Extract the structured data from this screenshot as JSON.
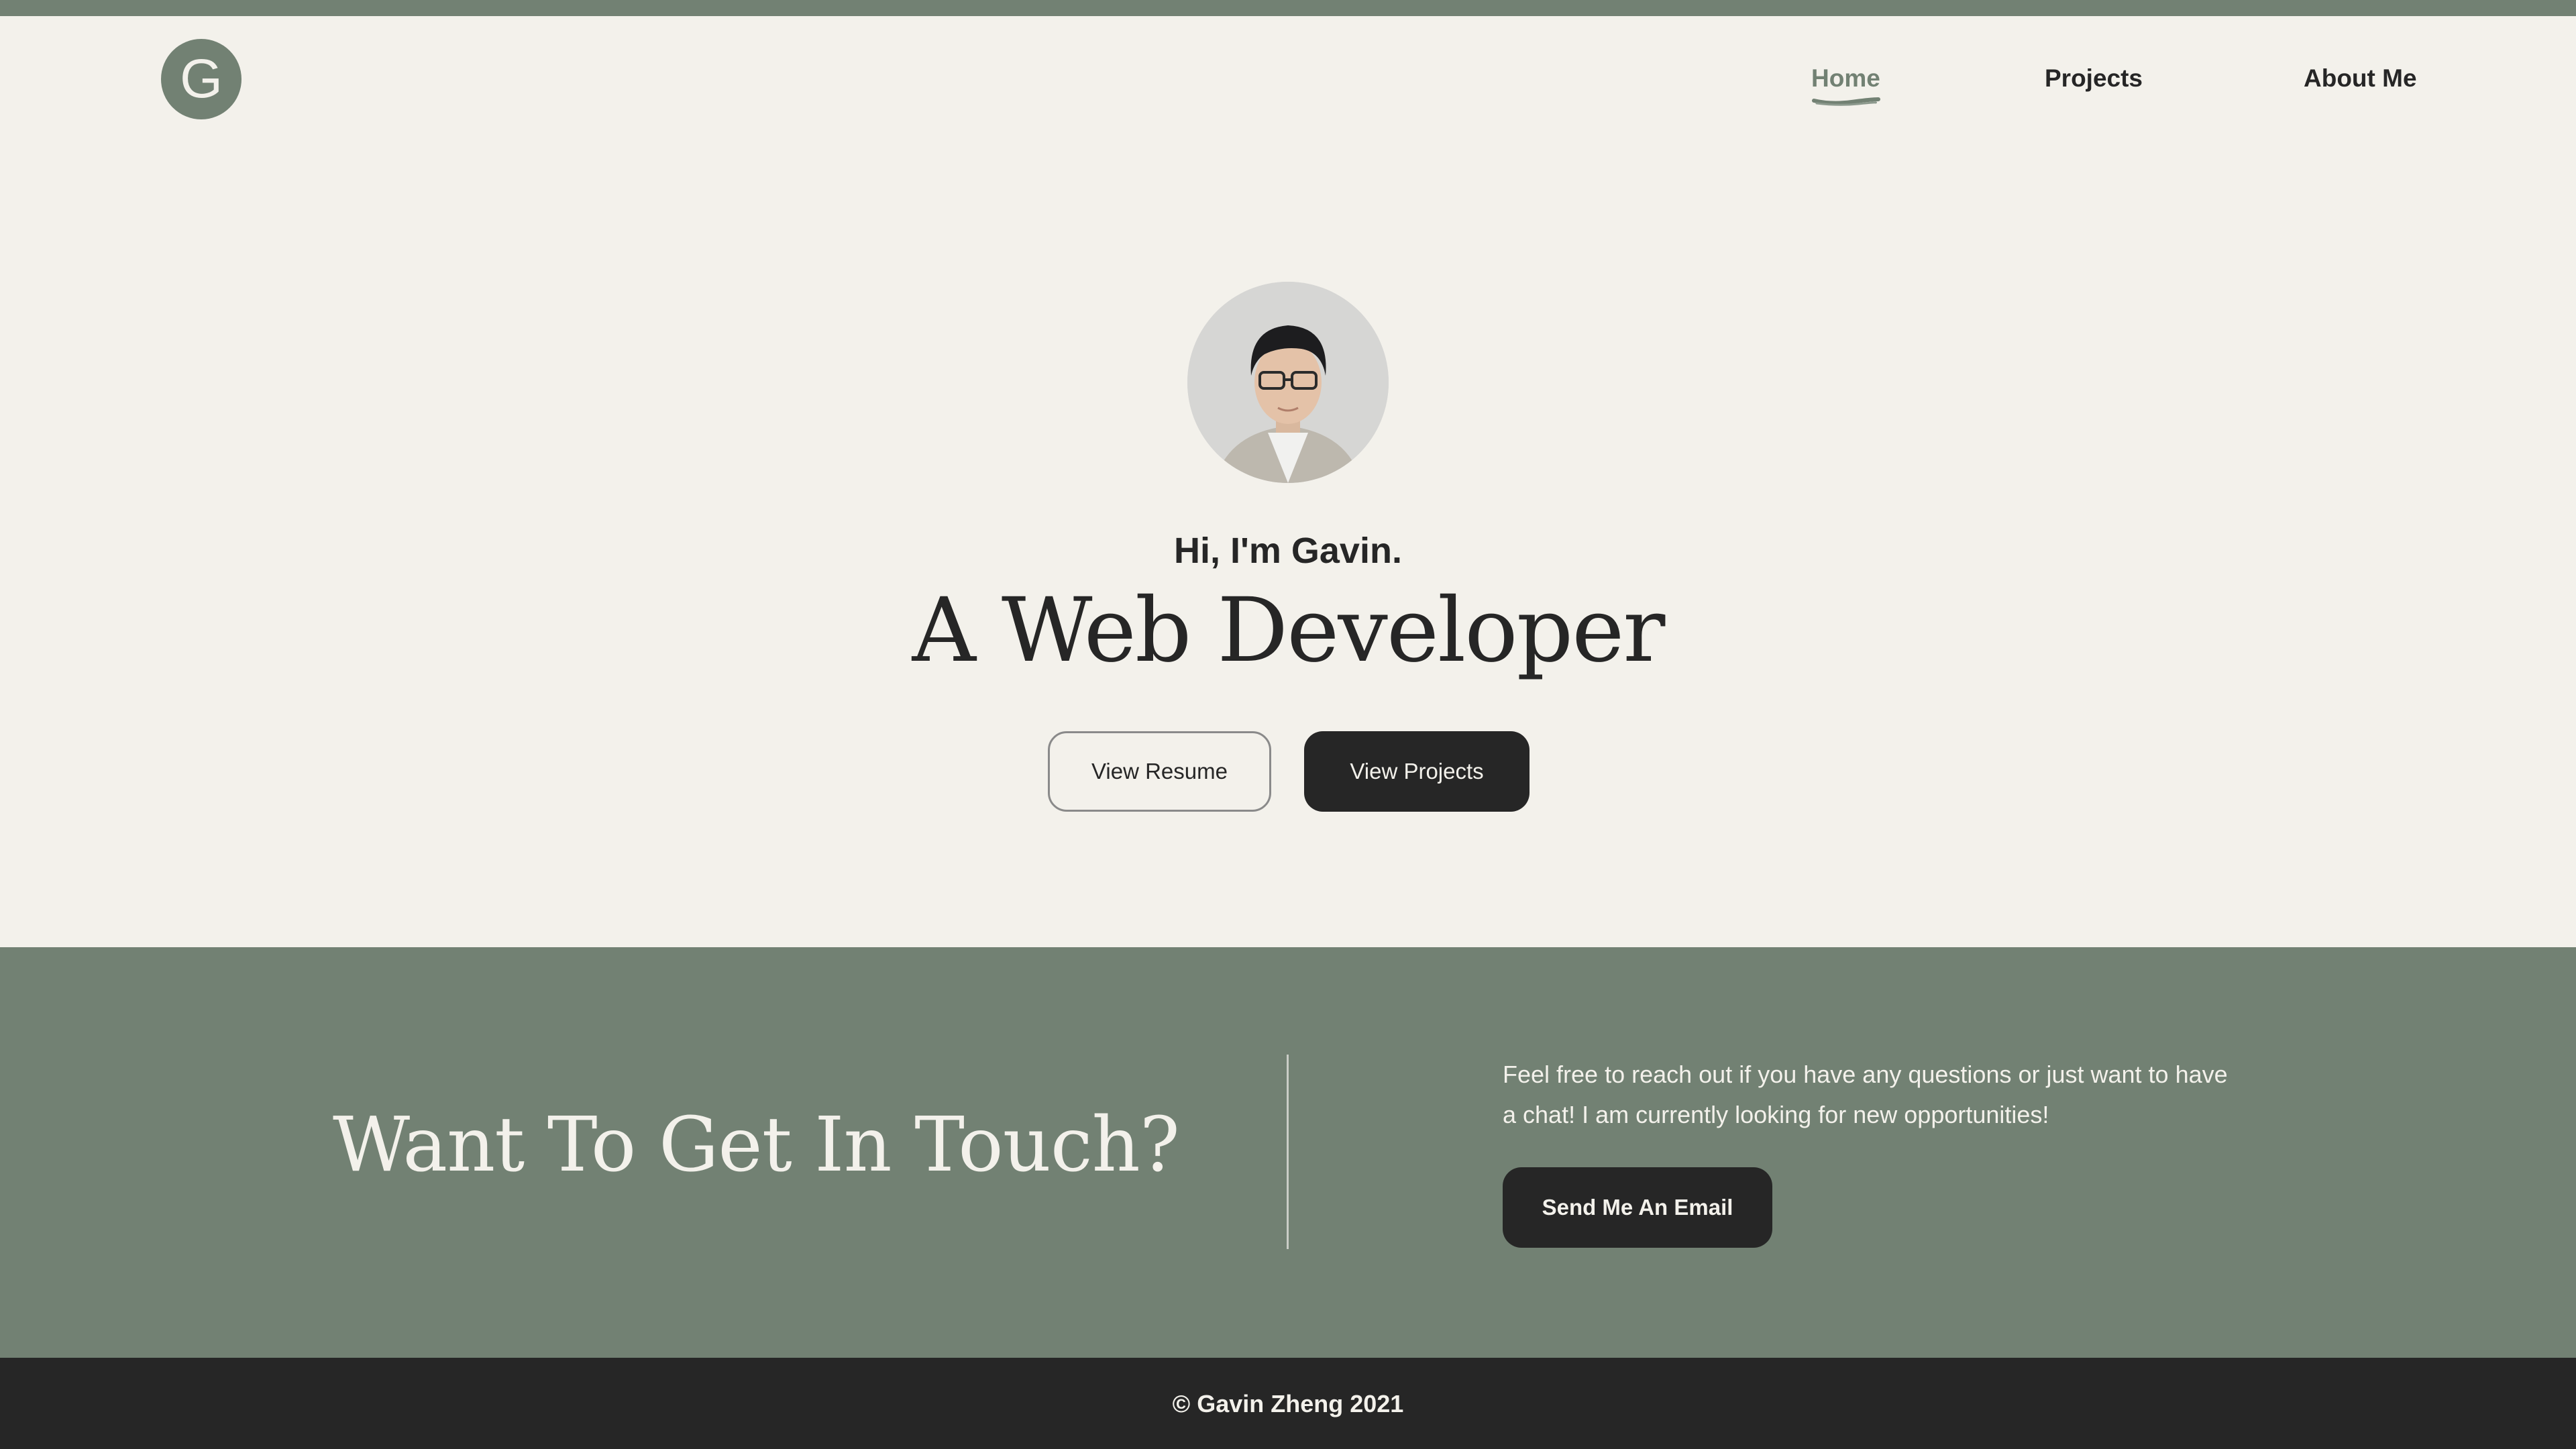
{
  "header": {
    "logo_letter": "G",
    "nav": [
      {
        "label": "Home",
        "active": true
      },
      {
        "label": "Projects",
        "active": false
      },
      {
        "label": "About Me",
        "active": false
      }
    ]
  },
  "hero": {
    "greeting": "Hi, I'm Gavin.",
    "headline": "A Web Developer",
    "resume_button": "View Resume",
    "projects_button": "View Projects"
  },
  "contact": {
    "title": "Want To Get In Touch?",
    "text": "Feel free to reach out if you have any questions or just want to have a chat! I am currently looking for new opportunities!",
    "email_button": "Send Me An Email"
  },
  "footer": {
    "copyright": "© Gavin Zheng 2021"
  },
  "colors": {
    "accent": "#728173",
    "dark": "#262626",
    "background": "#f3f1eb"
  }
}
